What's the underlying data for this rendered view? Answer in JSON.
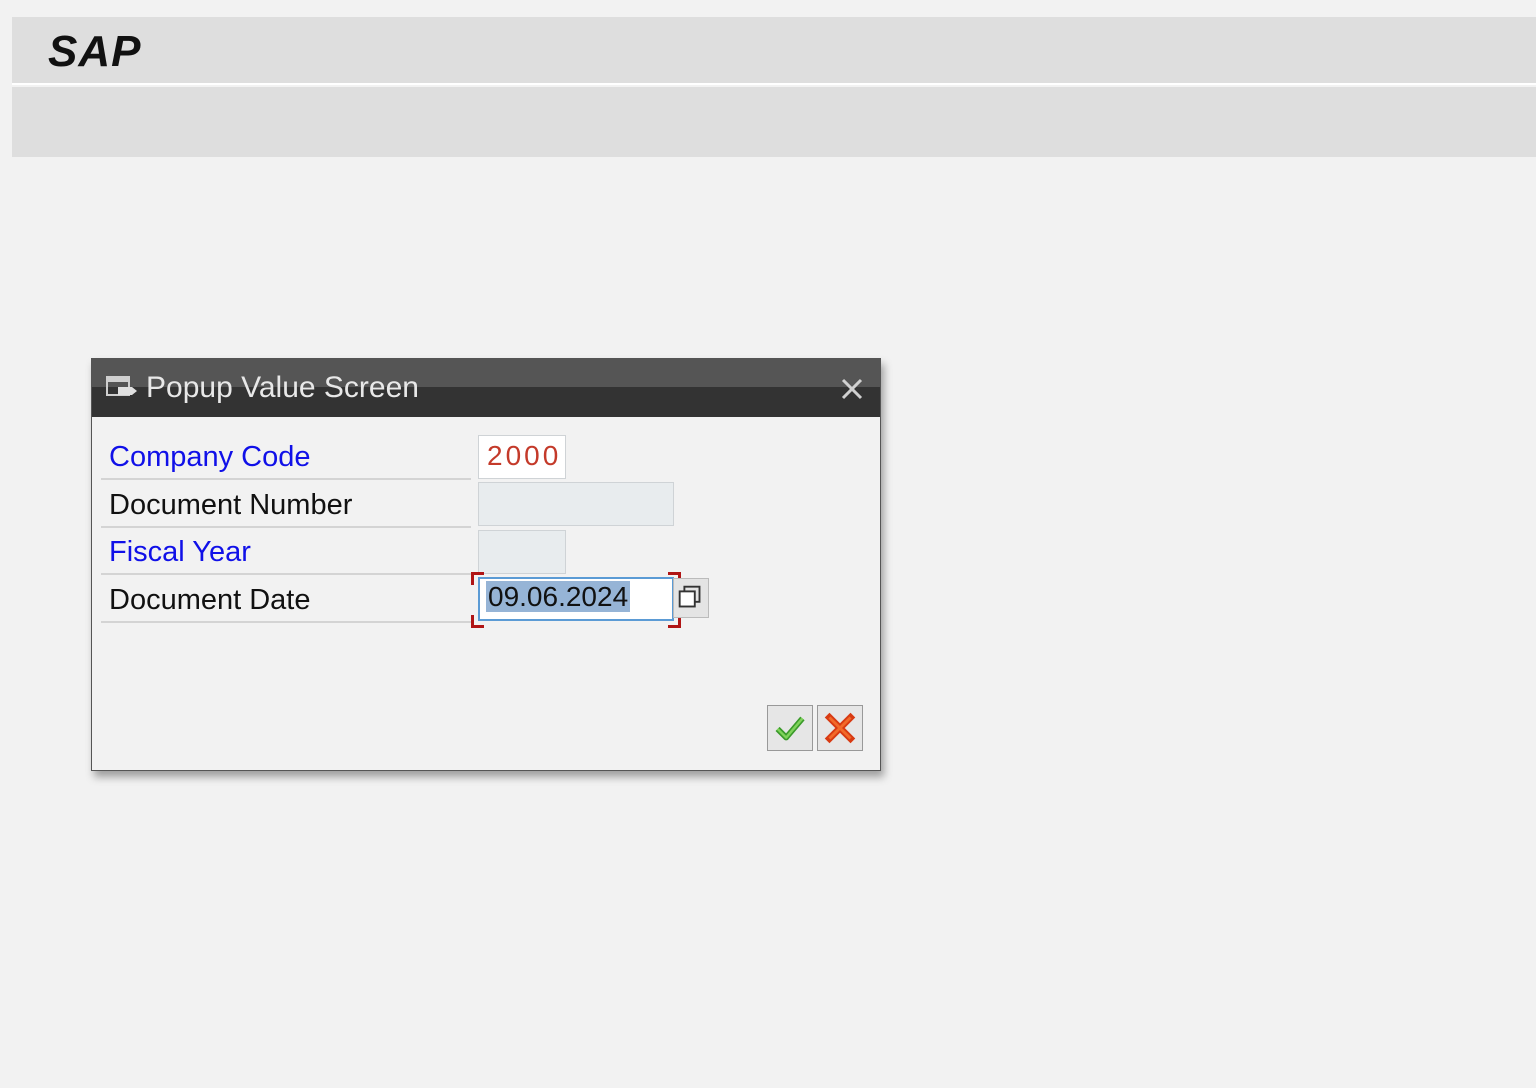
{
  "window": {
    "app_title": "SAP"
  },
  "dialog": {
    "title": "Popup Value Screen",
    "fields": {
      "company_code": {
        "label": "Company Code",
        "value": "2000"
      },
      "document_number": {
        "label": "Document Number",
        "value": ""
      },
      "fiscal_year": {
        "label": "Fiscal Year",
        "value": ""
      },
      "document_date": {
        "label": "Document Date",
        "value": "09.06.2024"
      }
    },
    "buttons": {
      "confirm_icon": "green-check-icon",
      "cancel_icon": "red-x-icon"
    }
  },
  "colors": {
    "label_blue": "#1010e8",
    "value_red": "#c43a2a",
    "header_dark": "#333333",
    "selection": "#96b4d6"
  }
}
